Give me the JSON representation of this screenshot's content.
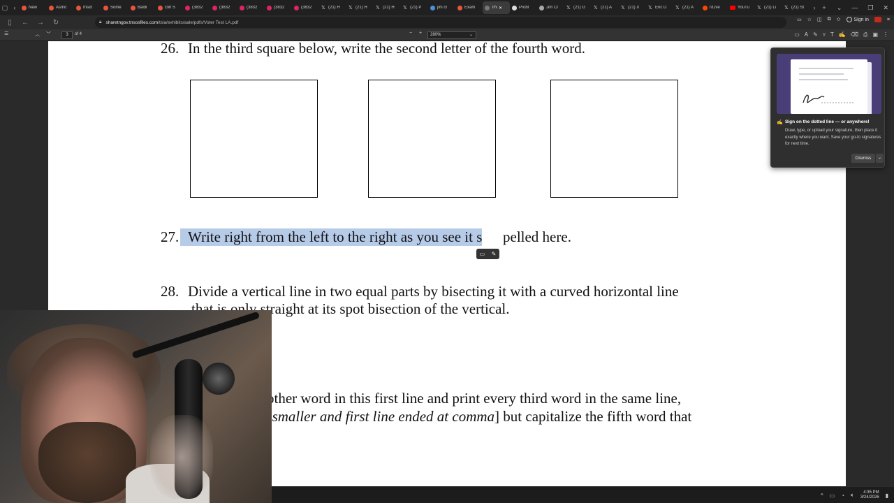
{
  "browser": {
    "tabs": [
      {
        "title": "New",
        "fav": "#e8553e"
      },
      {
        "title": "Asmo",
        "fav": "#e8553e"
      },
      {
        "title": "Insid",
        "fav": "#e8553e"
      },
      {
        "title": "Some",
        "fav": "#e8553e"
      },
      {
        "title": "Baldi",
        "fav": "#e8553e"
      },
      {
        "title": "Girl S",
        "fav": "#e8553e"
      },
      {
        "title": "(3832",
        "fav": "#e0245e"
      },
      {
        "title": "(3832",
        "fav": "#e0245e"
      },
      {
        "title": "(3832",
        "fav": "#e0245e"
      },
      {
        "title": "(3832",
        "fav": "#e0245e"
      },
      {
        "title": "(3832",
        "fav": "#e0245e"
      },
      {
        "title": "(21) H",
        "fav": "x"
      },
      {
        "title": "(21) H",
        "fav": "x"
      },
      {
        "title": "(21) H",
        "fav": "x"
      },
      {
        "title": "(21) P",
        "fav": "x"
      },
      {
        "title": "jim cr",
        "fav": "#4a90d9"
      },
      {
        "title": "Exam",
        "fav": "#e8553e"
      },
      {
        "title": "Th",
        "fav": "#777777",
        "active": true
      },
      {
        "title": "Probl",
        "fav": "#dddddd"
      },
      {
        "title": "Jim Cr",
        "fav": "#aaaaaa"
      },
      {
        "title": "(21) G",
        "fav": "x"
      },
      {
        "title": "(21) A",
        "fav": "x"
      },
      {
        "title": "(21) X",
        "fav": "x"
      },
      {
        "title": "Eric D",
        "fav": "x"
      },
      {
        "title": "(21) A",
        "fav": "x"
      },
      {
        "title": "r/Live",
        "fav": "#ff4500"
      },
      {
        "title": "YouTu",
        "fav": "yt"
      },
      {
        "title": "(21) Li",
        "fav": "x"
      },
      {
        "title": "(21) St",
        "fav": "x"
      }
    ],
    "new_tab": "+",
    "url_host": "sharetngov.tnsosfiles.com",
    "url_path": "/tsla/exhibits/aale/pdfs/Voter Test LA.pdf",
    "signin_label": "Sign in"
  },
  "pdf_toolbar": {
    "page_current": "3",
    "page_total": "of 4",
    "zoom": "280%"
  },
  "document": {
    "q26_num": "26.",
    "q26_text": "In the third square below, write the second letter of the fourth word.",
    "q27_num": "27.",
    "q27_selected": "Write right from the left to the right as you see it s",
    "q27_rest": "pelled here.",
    "q28_num": "28.",
    "q28_line1": "Divide a vertical line in two equal parts by bisecting it with a curved horizontal line",
    "q28_line2": "that is only straight at its spot bisection of the vertical.",
    "q29_line1": "other word in this first line and print every third word in the same line,",
    "q29_line2_italic": "e smaller and first line ended at comma",
    "q29_line2_rest": "] but capitalize the fifth word that"
  },
  "popup": {
    "title": "Sign on the dotted line — or anywhere!",
    "body": "Draw, type, or upload your signature, then place it exactly where you want. Save your go-to signatures for next time.",
    "dismiss": "Dismiss"
  },
  "taskbar": {
    "time": "4:35 PM",
    "date": "3/24/2026"
  }
}
